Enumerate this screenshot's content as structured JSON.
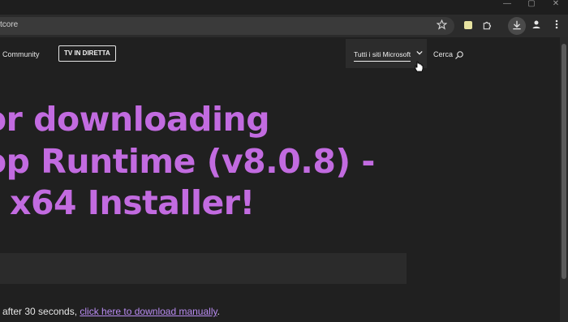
{
  "browser": {
    "url_fragment": "tcore",
    "window_controls": {
      "minimize": "—",
      "maximize": "▢",
      "close": "✕"
    },
    "toolbar_icons": [
      "star-icon",
      "extension-square-icon",
      "puzzle-icon",
      "download-icon",
      "profile-icon",
      "menu-icon"
    ]
  },
  "nav": {
    "community": "Community",
    "tv_live": "TV IN DIRETTA",
    "all_sites": "Tutti i siti Microsoft",
    "search": "Cerca"
  },
  "hero": {
    "line1": "or downloading",
    "line2": "op Runtime (v8.0.8) -",
    "line3": "x64 Installer!"
  },
  "download": {
    "prefix": "after 30 seconds, ",
    "link": "click here to download manually",
    "suffix": "."
  },
  "colors": {
    "accent": "#c26be0",
    "link": "#b98cf2",
    "background": "#202020"
  }
}
